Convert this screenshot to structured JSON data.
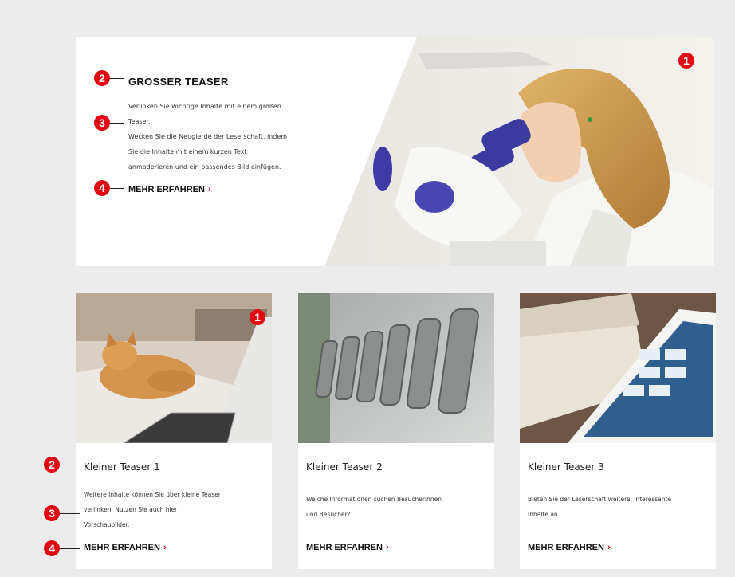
{
  "markers": {
    "m1": "1",
    "m2": "2",
    "m3": "3",
    "m4": "4"
  },
  "big_teaser": {
    "title": "GROSSER TEASER",
    "description_lines": [
      "Verlinken Sie wichtige Inhalte mit einem großen",
      "Teaser.",
      "Wecken Sie die Neugierde der Leserschaft, indem",
      "Sie die Inhalte mit einem kurzen Text",
      "anmoderieren und ein passendes Bild einfügen."
    ],
    "link_label": "MEHR ERFAHREN",
    "chevron": "›"
  },
  "cards": [
    {
      "title": "Kleiner Teaser 1",
      "description_lines": [
        "Weitere Inhalte können Sie über kleine Teaser",
        "verlinken. Nutzen Sie auch hier",
        "Vorschaubilder."
      ],
      "link_label": "MEHR ERFAHREN",
      "chevron": "›"
    },
    {
      "title": "Kleiner Teaser 2",
      "description_lines": [
        "Welche Informationen suchen Besucherinnen",
        "und Besucher?"
      ],
      "link_label": "MEHR ERFAHREN",
      "chevron": "›"
    },
    {
      "title": "Kleiner Teaser 3",
      "description_lines": [
        "Bieten Sie der Leserschaft weitere, interessante",
        "Inhalte an."
      ],
      "link_label": "MEHR ERFAHREN",
      "chevron": "›"
    }
  ],
  "images": {
    "big": "lab-scientist-microscope-photo",
    "card1": "cat-on-laptop-photo",
    "card2": "metal-numbers-on-wall-photo",
    "card3": "tablet-on-newspaper-photo"
  },
  "colors": {
    "accent": "#e30613",
    "background": "#ececec",
    "card": "#ffffff"
  }
}
